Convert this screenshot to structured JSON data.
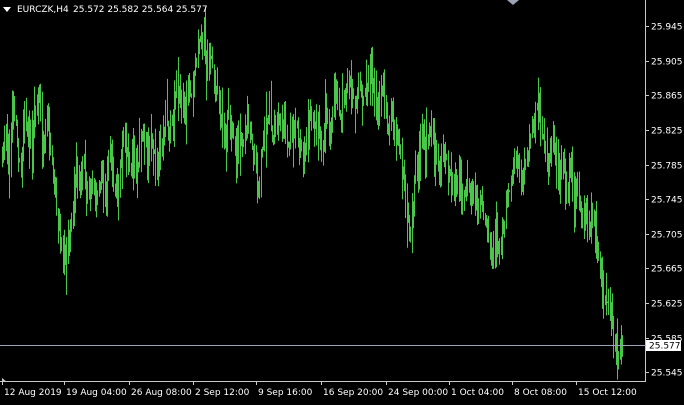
{
  "header": {
    "symbol": "EURCZK,H4",
    "ohlc": "25.572 25.582 25.564 25.577",
    "menu_icon": "triangle-down-icon"
  },
  "colors": {
    "background": "#000000",
    "bars": "#48c748",
    "axis": "#c8c8c8",
    "text": "#ffffff",
    "price_line": "#9aa4b4",
    "price_label_bg": "#ffffff",
    "price_label_text": "#000000"
  },
  "chart_data": {
    "type": "bar",
    "title": "EURCZK,H4",
    "xlabel": "",
    "ylabel": "",
    "ylim": [
      25.535,
      25.975
    ],
    "y_ticks": [
      25.945,
      25.905,
      25.865,
      25.825,
      25.785,
      25.745,
      25.705,
      25.665,
      25.625,
      25.585,
      25.545
    ],
    "x_ticks": [
      "12 Aug 2019",
      "19 Aug 04:00",
      "26 Aug 08:00",
      "2 Sep 12:00",
      "9 Sep 16:00",
      "16 Sep 20:00",
      "24 Sep 00:00",
      "1 Oct 04:00",
      "8 Oct 08:00",
      "15 Oct 12:00"
    ],
    "current_price": 25.577,
    "closes": [
      25.8,
      25.83,
      25.78,
      25.86,
      25.81,
      25.78,
      25.84,
      25.82,
      25.8,
      25.85,
      25.87,
      25.79,
      25.85,
      25.8,
      25.77,
      25.72,
      25.69,
      25.67,
      25.71,
      25.74,
      25.78,
      25.76,
      25.79,
      25.75,
      25.77,
      25.73,
      25.75,
      25.78,
      25.76,
      25.8,
      25.77,
      25.74,
      25.79,
      25.82,
      25.78,
      25.8,
      25.76,
      25.81,
      25.84,
      25.79,
      25.82,
      25.8,
      25.78,
      25.81,
      25.85,
      25.82,
      25.85,
      25.87,
      25.86,
      25.84,
      25.88,
      25.87,
      25.9,
      25.92,
      25.94,
      25.89,
      25.91,
      25.88,
      25.86,
      25.83,
      25.81,
      25.84,
      25.82,
      25.79,
      25.82,
      25.8,
      25.84,
      25.82,
      25.79,
      25.76,
      25.81,
      25.83,
      25.84,
      25.81,
      25.85,
      25.83,
      25.84,
      25.8,
      25.82,
      25.84,
      25.81,
      25.79,
      25.82,
      25.85,
      25.82,
      25.83,
      25.8,
      25.84,
      25.82,
      25.85,
      25.87,
      25.84,
      25.86,
      25.89,
      25.87,
      25.85,
      25.88,
      25.87,
      25.86,
      25.89,
      25.87,
      25.85,
      25.87,
      25.86,
      25.83,
      25.85,
      25.82,
      25.8,
      25.78,
      25.73,
      25.71,
      25.76,
      25.79,
      25.82,
      25.8,
      25.83,
      25.81,
      25.79,
      25.78,
      25.81,
      25.79,
      25.77,
      25.76,
      25.78,
      25.75,
      25.77,
      25.74,
      25.76,
      25.73,
      25.75,
      25.72,
      25.7,
      25.68,
      25.71,
      25.69,
      25.72,
      25.75,
      25.77,
      25.79,
      25.78,
      25.76,
      25.79,
      25.81,
      25.83,
      25.86,
      25.83,
      25.81,
      25.79,
      25.81,
      25.8,
      25.77,
      25.79,
      25.75,
      25.78,
      25.74,
      25.76,
      25.73,
      25.74,
      25.71,
      25.73,
      25.69,
      25.66,
      25.64,
      25.62,
      25.6,
      25.58,
      25.56,
      25.577
    ]
  }
}
